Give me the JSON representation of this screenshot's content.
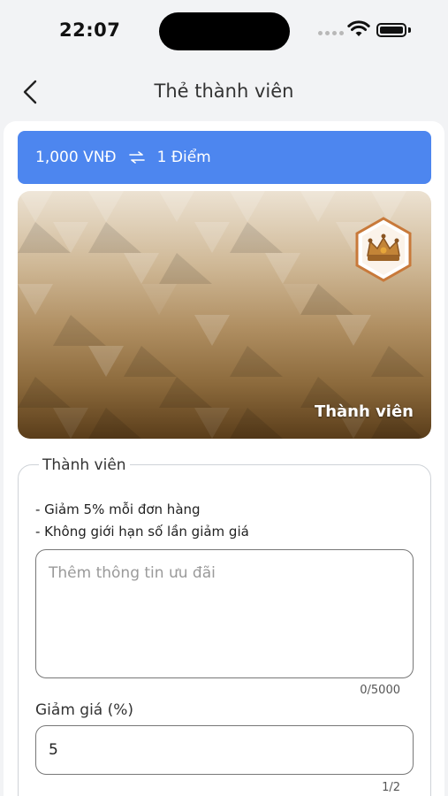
{
  "status_bar": {
    "time": "22:07"
  },
  "header": {
    "title": "Thẻ thành viên"
  },
  "exchange": {
    "amount": "1,000 VNĐ",
    "points": "1 Điểm"
  },
  "card": {
    "label": "Thành viên"
  },
  "tier": {
    "legend": "Thành viên",
    "benefits": [
      "- Giảm 5% mỗi đơn hàng",
      "- Không giới hạn số lần giảm giá"
    ],
    "offer_placeholder": "Thêm thông tin ưu đãi",
    "offer_counter": "0/5000",
    "discount_label": "Giảm giá (%)",
    "discount_value": "5",
    "discount_counter": "1/2"
  },
  "colors": {
    "accent": "#4d86ef",
    "card_gold": "#b08f62"
  }
}
